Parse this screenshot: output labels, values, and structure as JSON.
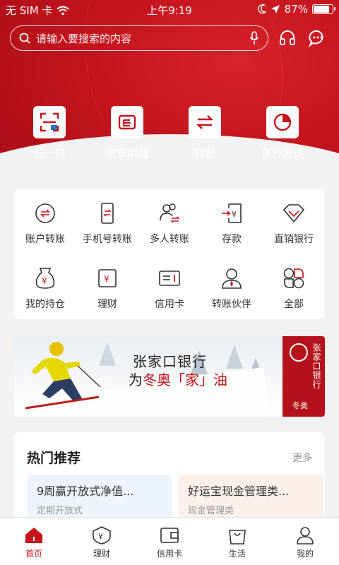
{
  "status": {
    "carrier": "无 SIM 卡",
    "time": "上午9:19",
    "battery": "87%",
    "battery_level": 0.87
  },
  "search": {
    "placeholder": "请输入要搜索的内容"
  },
  "quick_actions": [
    {
      "label": "扫一扫",
      "icon": "scan-icon"
    },
    {
      "label": "收支明细",
      "icon": "statement-icon"
    },
    {
      "label": "转账",
      "icon": "transfer-icon"
    },
    {
      "label": "账户总览",
      "icon": "pie-chart-icon"
    }
  ],
  "services": [
    {
      "label": "账户转账",
      "icon": "account-transfer-icon"
    },
    {
      "label": "手机号转账",
      "icon": "phone-transfer-icon"
    },
    {
      "label": "多人转账",
      "icon": "multi-transfer-icon"
    },
    {
      "label": "存款",
      "icon": "deposit-icon"
    },
    {
      "label": "直销银行",
      "icon": "diamond-icon"
    },
    {
      "label": "我的持仓",
      "icon": "money-bag-icon"
    },
    {
      "label": "理财",
      "icon": "wealth-icon"
    },
    {
      "label": "信用卡",
      "icon": "credit-card-icon"
    },
    {
      "label": "转账伙伴",
      "icon": "contact-icon"
    },
    {
      "label": "全部",
      "icon": "grid-all-icon"
    }
  ],
  "banner": {
    "line1": "张家口银行",
    "line2_prefix": "为",
    "line2_highlight": "冬奥「家」油",
    "bank_name": "张家口银行",
    "sub": "冬奥"
  },
  "hot": {
    "title": "热门推荐",
    "more": "更多",
    "products": [
      {
        "title": "9周赢开放式净值...",
        "subtitle": "定期开放式"
      },
      {
        "title": "好运宝现金管理类...",
        "subtitle": "现金管理类"
      }
    ]
  },
  "tabs": [
    {
      "label": "首页",
      "icon": "home-icon",
      "active": true
    },
    {
      "label": "理财",
      "icon": "wealth-shield-icon",
      "active": false
    },
    {
      "label": "信用卡",
      "icon": "wallet-icon",
      "active": false
    },
    {
      "label": "生活",
      "icon": "shopping-bag-icon",
      "active": false
    },
    {
      "label": "我的",
      "icon": "profile-icon",
      "active": false
    }
  ],
  "colors": {
    "brand_red": "#c4161c",
    "bg": "#f2f2f2",
    "muted": "#999999"
  }
}
